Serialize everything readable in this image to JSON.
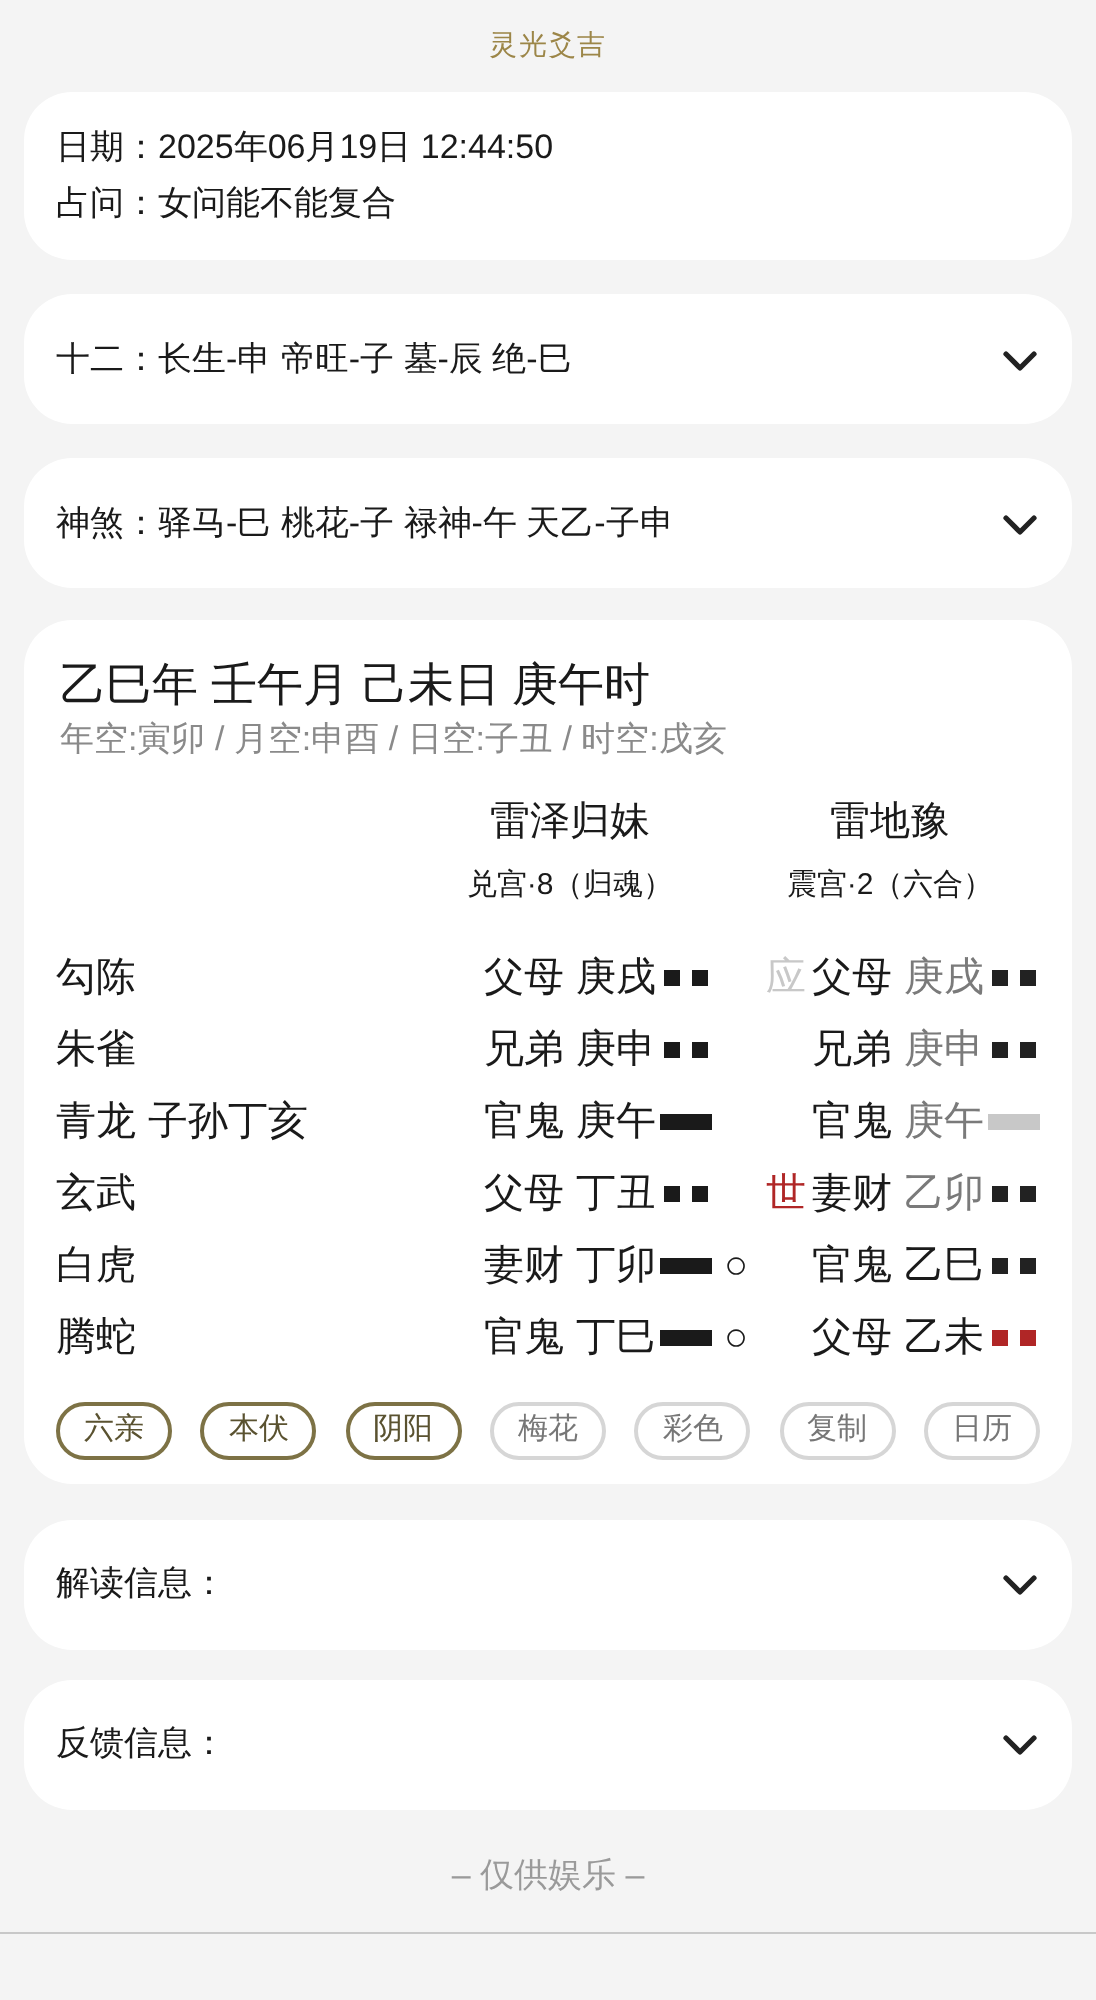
{
  "title": "灵光爻吉",
  "info": {
    "lines": [
      "日期：2025年06月19日 12:44:50",
      "占问：女问能不能复合"
    ]
  },
  "summaries": [
    {
      "text": "十二：长生-申 帝旺-子 墓-辰 绝-巳",
      "expanded": false
    },
    {
      "text": "神煞：驿马-巳 桃花-子 禄神-午 天乙-子申",
      "expanded": false
    }
  ],
  "chart": {
    "pillars": "乙巳年 壬午月 己未日 庚午时",
    "voids": "年空:寅卯 / 月空:申酉 / 日空:子丑 / 时空:戌亥",
    "hexagrams": [
      {
        "name": "雷泽归妹",
        "palace": "兑宫·8（归魂）"
      },
      {
        "name": "雷地豫",
        "palace": "震宫·2（六合）"
      }
    ],
    "rows": [
      {
        "god": "勾陈",
        "left": {
          "relation": "父母",
          "ganzhi": "庚戌",
          "yang": false
        },
        "mark": {
          "text": "应",
          "kind": "ying"
        },
        "right": {
          "relation": "父母",
          "ganzhi": "庚戌",
          "dim": true,
          "yang": false,
          "color": "#222222"
        }
      },
      {
        "god": "朱雀",
        "left": {
          "relation": "兄弟",
          "ganzhi": "庚申",
          "yang": false
        },
        "right": {
          "relation": "兄弟",
          "ganzhi": "庚申",
          "dim": true,
          "yang": false,
          "color": "#222222"
        }
      },
      {
        "god": "青龙",
        "hidden": "子孙丁亥",
        "left": {
          "relation": "官鬼",
          "ganzhi": "庚午",
          "yang": true
        },
        "right": {
          "relation": "官鬼",
          "ganzhi": "庚午",
          "dim": true,
          "yang": true,
          "color": "#c8c8c8"
        }
      },
      {
        "god": "玄武",
        "left": {
          "relation": "父母",
          "ganzhi": "丁丑",
          "yang": false
        },
        "mark": {
          "text": "世",
          "kind": "shi"
        },
        "right": {
          "relation": "妻财",
          "ganzhi": "乙卯",
          "dim": true,
          "yang": false,
          "color": "#222222"
        }
      },
      {
        "god": "白虎",
        "left": {
          "relation": "妻财",
          "ganzhi": "丁卯",
          "yang": true,
          "moving": "○"
        },
        "right": {
          "relation": "官鬼",
          "ganzhi": "乙巳",
          "dim": false,
          "yang": false,
          "color": "#222222"
        }
      },
      {
        "god": "腾蛇",
        "left": {
          "relation": "官鬼",
          "ganzhi": "丁巳",
          "yang": true,
          "moving": "○"
        },
        "right": {
          "relation": "父母",
          "ganzhi": "乙未",
          "dim": false,
          "yang": false,
          "color": "#b02626"
        }
      }
    ],
    "toggles": [
      {
        "label": "六亲",
        "selected": true
      },
      {
        "label": "本伏",
        "selected": true
      },
      {
        "label": "阴阳",
        "selected": true
      },
      {
        "label": "梅花",
        "selected": false
      },
      {
        "label": "彩色",
        "selected": false
      },
      {
        "label": "复制",
        "selected": false
      },
      {
        "label": "日历",
        "selected": false
      }
    ]
  },
  "sections": [
    {
      "label": "解读信息：",
      "expanded": false
    },
    {
      "label": "反馈信息：",
      "expanded": false
    }
  ],
  "footer": "– 仅供娱乐 –"
}
